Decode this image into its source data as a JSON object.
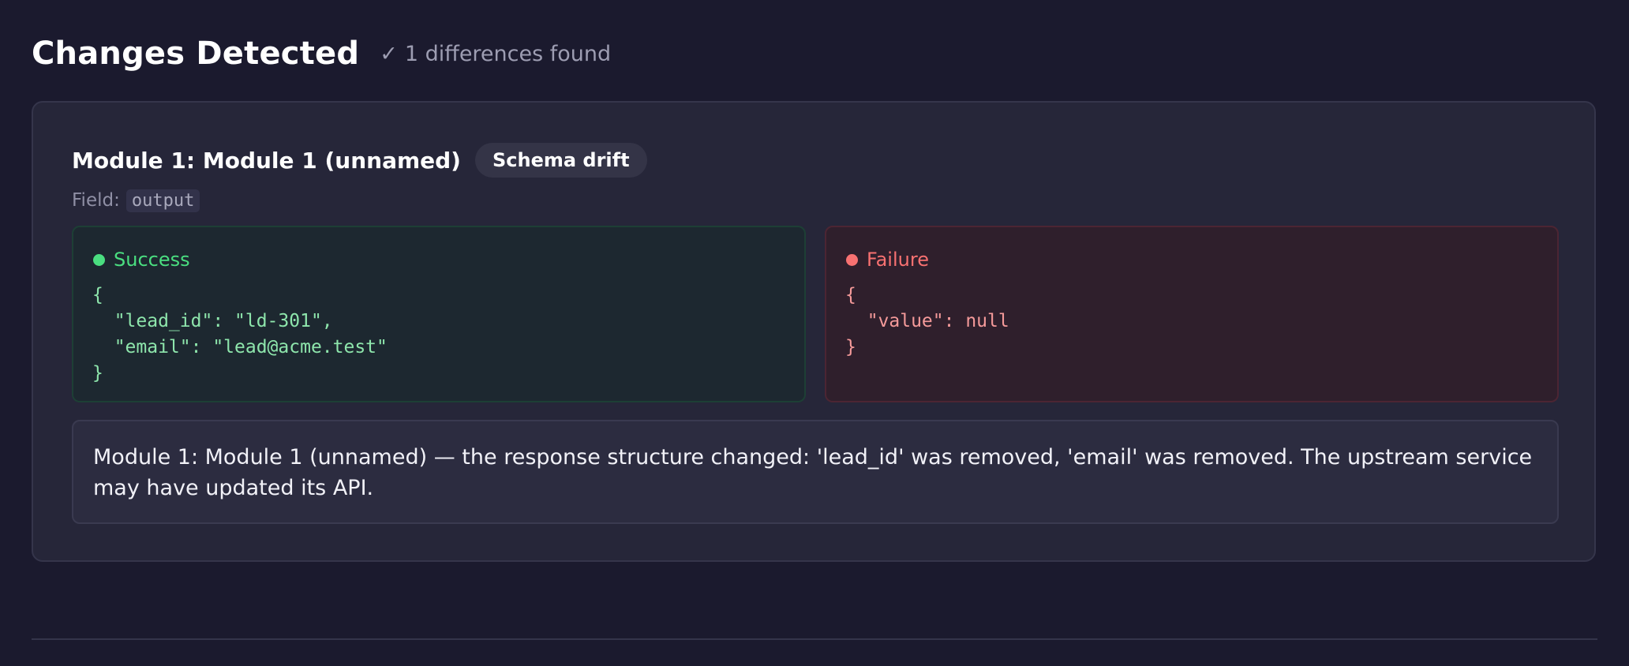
{
  "header": {
    "title": "Changes Detected",
    "check_glyph": "✓",
    "difference_count_label": "1 differences found"
  },
  "module": {
    "title": "Module 1: Module 1 (unnamed)",
    "badge": "Schema drift",
    "field_label": "Field:",
    "field_value": "output"
  },
  "success_panel": {
    "label": "Success",
    "color": "#4ade80",
    "lines": [
      "{",
      "  \"lead_id\": \"ld-301\",",
      "  \"email\": \"lead@acme.test\"",
      "}"
    ]
  },
  "failure_panel": {
    "label": "Failure",
    "color": "#f87171",
    "lines": [
      "{",
      "  \"value\": null",
      "}"
    ]
  },
  "message": "Module 1: Module 1 (unnamed) — the response structure changed: 'lead_id' was removed, 'email' was removed. The upstream service may have updated its API.",
  "icons": {
    "check": "check-icon",
    "success_status": "green-dot-icon",
    "failure_status": "red-dot-icon"
  }
}
